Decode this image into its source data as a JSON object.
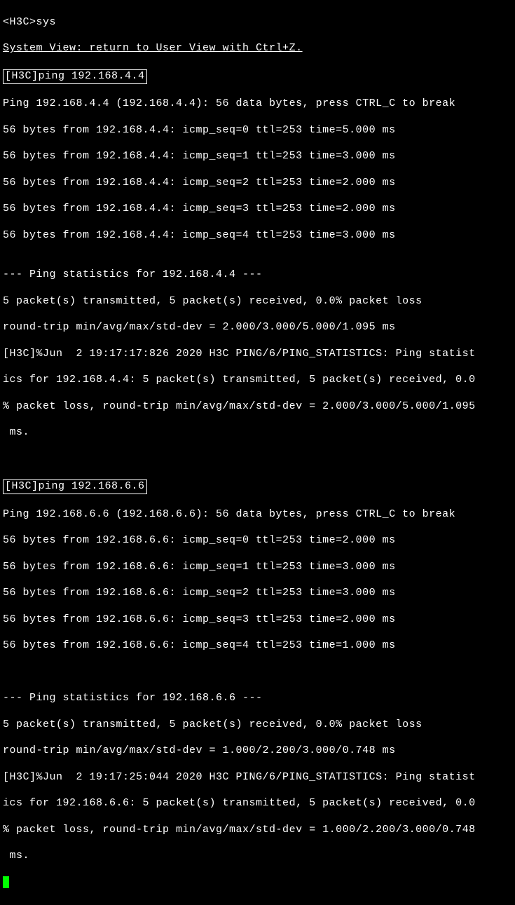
{
  "term": {
    "l0": "<H3C>sys",
    "l1": "System View: return to User View with Ctrl+Z.",
    "cmd1": "[H3C]ping 192.168.4.4",
    "p1_0": "Ping 192.168.4.4 (192.168.4.4): 56 data bytes, press CTRL_C to break",
    "p1_1": "56 bytes from 192.168.4.4: icmp_seq=0 ttl=253 time=5.000 ms",
    "p1_2": "56 bytes from 192.168.4.4: icmp_seq=1 ttl=253 time=3.000 ms",
    "p1_3": "56 bytes from 192.168.4.4: icmp_seq=2 ttl=253 time=2.000 ms",
    "p1_4": "56 bytes from 192.168.4.4: icmp_seq=3 ttl=253 time=2.000 ms",
    "p1_5": "56 bytes from 192.168.4.4: icmp_seq=4 ttl=253 time=3.000 ms",
    "p1_blank": "",
    "p1_stats_hdr": "--- Ping statistics for 192.168.4.4 ---",
    "p1_stats_1": "5 packet(s) transmitted, 5 packet(s) received, 0.0% packet loss",
    "p1_stats_2": "round-trip min/avg/max/std-dev = 2.000/3.000/5.000/1.095 ms",
    "p1_log_1": "[H3C]%Jun  2 19:17:17:826 2020 H3C PING/6/PING_STATISTICS: Ping statist",
    "p1_log_2": "ics for 192.168.4.4: 5 packet(s) transmitted, 5 packet(s) received, 0.0",
    "p1_log_3": "% packet loss, round-trip min/avg/max/std-dev = 2.000/3.000/5.000/1.095",
    "p1_log_4": " ms.",
    "blank2": "",
    "cmd2": "[H3C]ping 192.168.6.6",
    "p2_0": "Ping 192.168.6.6 (192.168.6.6): 56 data bytes, press CTRL_C to break",
    "p2_1": "56 bytes from 192.168.6.6: icmp_seq=0 ttl=253 time=2.000 ms",
    "p2_2": "56 bytes from 192.168.6.6: icmp_seq=1 ttl=253 time=3.000 ms",
    "p2_3": "56 bytes from 192.168.6.6: icmp_seq=2 ttl=253 time=3.000 ms",
    "p2_4": "56 bytes from 192.168.6.6: icmp_seq=3 ttl=253 time=2.000 ms",
    "p2_5": "56 bytes from 192.168.6.6: icmp_seq=4 ttl=253 time=1.000 ms",
    "p2_blank": "",
    "p2_stats_hdr": "--- Ping statistics for 192.168.6.6 ---",
    "p2_stats_1": "5 packet(s) transmitted, 5 packet(s) received, 0.0% packet loss",
    "p2_stats_2": "round-trip min/avg/max/std-dev = 1.000/2.200/3.000/0.748 ms",
    "p2_log_1": "[H3C]%Jun  2 19:17:25:044 2020 H3C PING/6/PING_STATISTICS: Ping statist",
    "p2_log_2": "ics for 192.168.6.6: 5 packet(s) transmitted, 5 packet(s) received, 0.0",
    "p2_log_3": "% packet loss, round-trip min/avg/max/std-dev = 1.000/2.200/3.000/0.748",
    "p2_log_4": " ms."
  }
}
